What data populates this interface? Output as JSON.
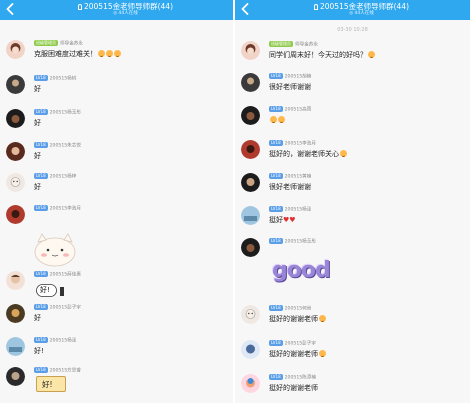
{
  "left": {
    "title": "200515金老师导师群(44)",
    "subtitle": "◎ 44人在线",
    "messages": [
      {
        "teacher_badge": "班级管理员",
        "name": "师导金苏永",
        "text": "克服困难度过难关！"
      },
      {
        "level": "LV18",
        "name": "200515杨树",
        "text": "好"
      },
      {
        "level": "LV18",
        "name": "200515杨玉彤",
        "text": "好"
      },
      {
        "level": "LV18",
        "name": "200515朱芯悦",
        "text": "好"
      },
      {
        "level": "LV18",
        "name": "200515杨梓",
        "text": "好"
      },
      {
        "level": "LV18",
        "name": "200515李浩月",
        "text": ""
      },
      {
        "level": "LV18",
        "name": "200515薛佳惠",
        "text": "好!"
      },
      {
        "level": "LV18",
        "name": "200515彭子宇",
        "text": "好"
      },
      {
        "level": "LV18",
        "name": "200515杨泽",
        "text": "好!"
      },
      {
        "level": "LV18",
        "name": "200515方思睿",
        "text": ""
      }
    ],
    "sticker_hao": "好!",
    "sticker_hao2": "好!"
  },
  "right": {
    "title": "200515金老师导师群(44)",
    "subtitle": "◎ 44人在线",
    "timestamp": "03-30 10:28",
    "messages": [
      {
        "teacher_badge": "班级管理员",
        "name": "师导金苏永",
        "text": "同学们周末好！今天过的好吗？"
      },
      {
        "level": "LV18",
        "name": "200515胡楠",
        "text": "很好老师谢谢"
      },
      {
        "level": "LV18",
        "name": "200515高雨",
        "text": ""
      },
      {
        "level": "LV18",
        "name": "200515李浩月",
        "text": "挺好的，谢谢老师关心"
      },
      {
        "level": "LV18",
        "name": "200515黄楠",
        "text": "很好老师谢谢"
      },
      {
        "level": "LV18",
        "name": "200515杨泽",
        "text": "挺好"
      },
      {
        "level": "LV18",
        "name": "200515杨玉彤",
        "text": ""
      },
      {
        "level": "LV18",
        "name": "200515何尚",
        "text": "挺好的谢谢老师"
      },
      {
        "level": "LV18",
        "name": "200515彭子宇",
        "text": "挺好的谢谢老师"
      },
      {
        "level": "LV18",
        "name": "200515陈添楠",
        "text": "挺好的谢谢老师"
      }
    ],
    "sticker_good": "good"
  },
  "colors": {
    "header": "#2fa8f0",
    "background": "#f7f7f7",
    "teacher_badge": "#8fcb4a",
    "level_badge": "#5a9ee8"
  },
  "icons": [
    "back-arrow-icon",
    "pin-icon",
    "smile-emoji-icon",
    "heart-icon",
    "cat-sticker-icon"
  ]
}
